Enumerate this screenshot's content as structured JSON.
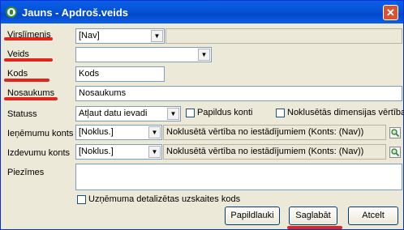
{
  "window": {
    "title": "Jauns - Apdroš.veids",
    "close": "✕"
  },
  "labels": {
    "virslimenis": "Virslīmenis",
    "veids": "Veids",
    "kods": "Kods",
    "nosaukums": "Nosaukums",
    "statuss": "Statuss",
    "ienemumu_konts": "Ieņēmumu konts",
    "izdevumu_konts": "Izdevumu konts",
    "piezimes": "Piezīmes"
  },
  "fields": {
    "virslimenis": "[Nav]",
    "veids": "",
    "kods": "Kods",
    "nosaukums": "Nosaukums",
    "statuss": "Atļaut datu ievadi",
    "ienemumu_konts": "[Noklus.]",
    "ienemumu_desc": "Noklusētā vērtība no iestādījumiem (Konts: (Nav))",
    "izdevumu_konts": "[Noklus.]",
    "izdevumu_desc": "Noklusētā vērtība no iestādījumiem (Konts: (Nav))",
    "piezimes": ""
  },
  "checkboxes": {
    "papildus_konti": {
      "label": "Papildus konti",
      "checked": false
    },
    "noklusetas_dimensijas": {
      "label": "Noklusētās dimensijas vērtības",
      "checked": false
    },
    "uznemuma_uzskaite": {
      "label": "Uzņēmuma detalizētas uzskaites kods",
      "checked": false
    }
  },
  "buttons": {
    "papildlauki": "Papildlauki",
    "saglabat": "Saglabāt",
    "atcelt": "Atcelt"
  },
  "colors": {
    "highlight": "#e0251b",
    "titlebar": "#0553d6"
  }
}
